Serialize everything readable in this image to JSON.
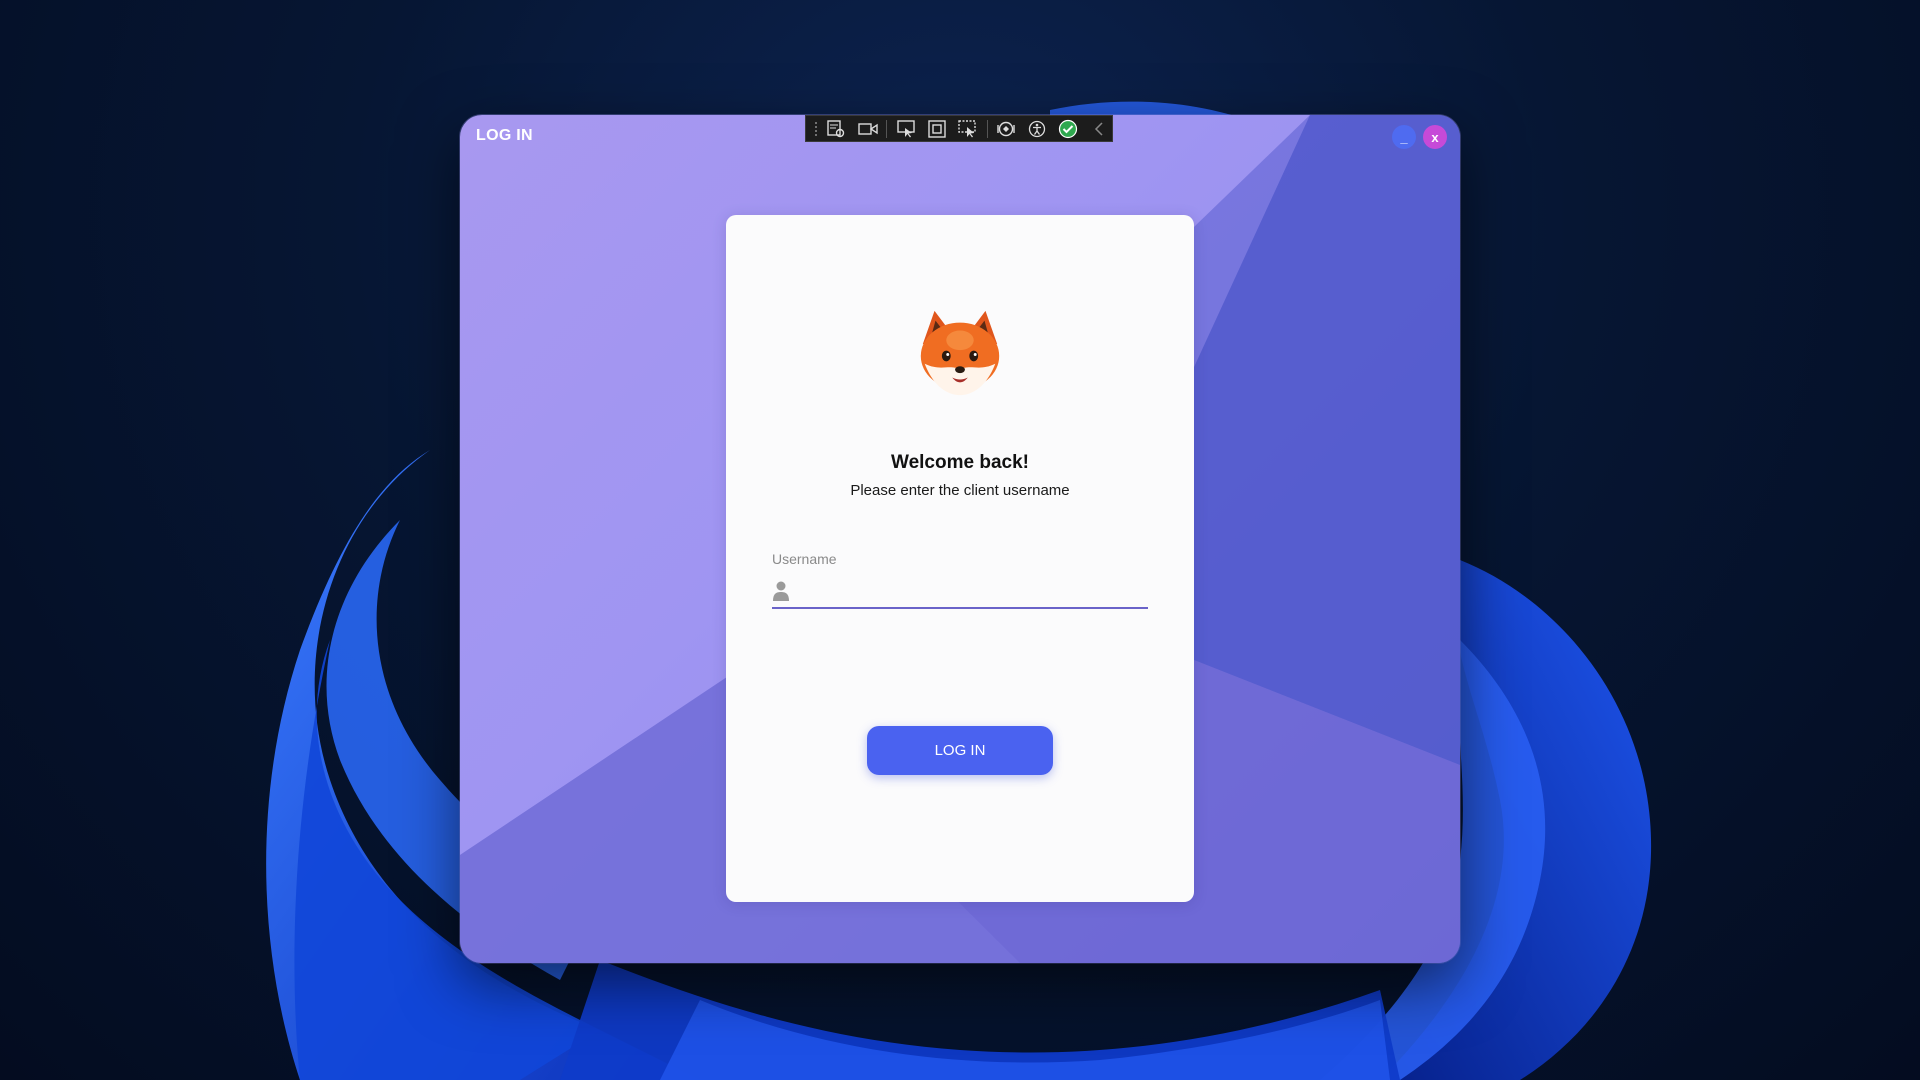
{
  "window": {
    "title": "LOG IN",
    "minimize_label": "_",
    "close_label": "x"
  },
  "toolbar": {
    "icons": [
      "live-visual-tree-icon",
      "record-icon",
      "select-element-icon",
      "display-layout-adorners-icon",
      "track-focused-element-icon",
      "hot-reload-icon",
      "accessibility-icon",
      "binding-check-icon",
      "collapse-chevron-icon"
    ]
  },
  "login_card": {
    "avatar": "fox-avatar-icon",
    "heading": "Welcome back!",
    "subheading": "Please enter the client username",
    "username_label": "Username",
    "username_value": "",
    "button_label": "LOG IN"
  },
  "colors": {
    "accent": "#4a62f0",
    "close_button": "#c64ad8",
    "minimize_button": "#4f6bf0",
    "window_bg": "#9f95f2"
  }
}
